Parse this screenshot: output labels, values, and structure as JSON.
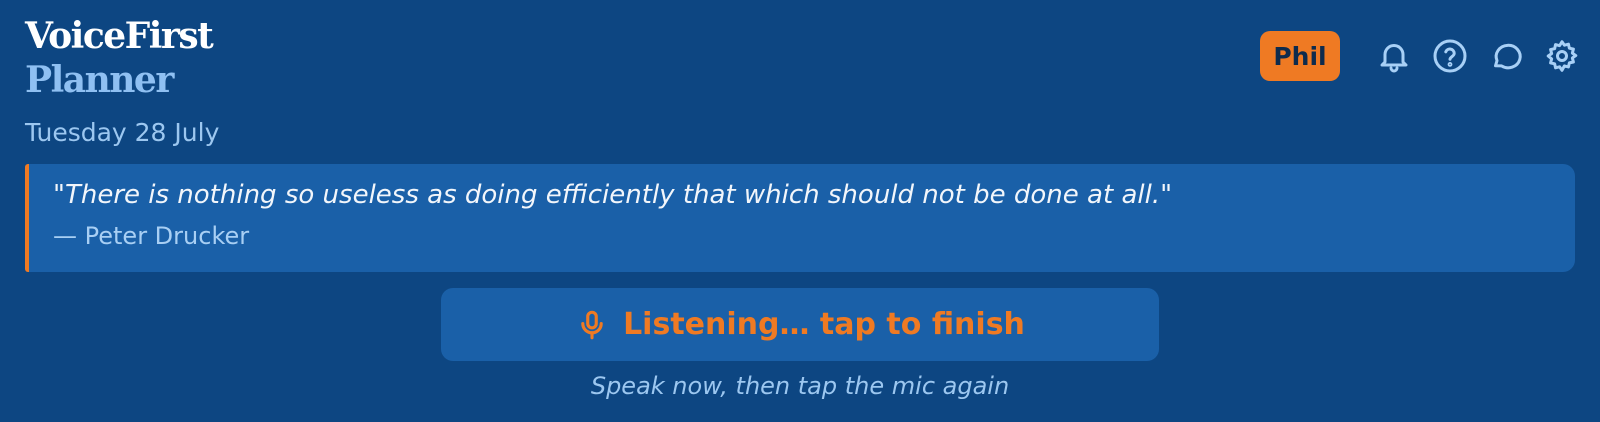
{
  "app": {
    "brand_line1": "VoiceFirst",
    "brand_line2": "Planner"
  },
  "date": "Tuesday 28 July",
  "header": {
    "user_name": "Phil",
    "icons": [
      "bell-icon",
      "help-icon",
      "chat-icon",
      "settings-icon"
    ]
  },
  "quote": {
    "text": "\"There is nothing so useless as doing efficiently that which should not be done at all.\"",
    "author": "— Peter Drucker"
  },
  "voice": {
    "button_label": "Listening… tap to finish",
    "icon": "mic-icon",
    "hint": "Speak now, then tap the mic again"
  },
  "colors": {
    "background": "#0d4682",
    "card": "#1a60a8",
    "accent": "#ef7a23",
    "muted_text": "#9cc7f0"
  }
}
